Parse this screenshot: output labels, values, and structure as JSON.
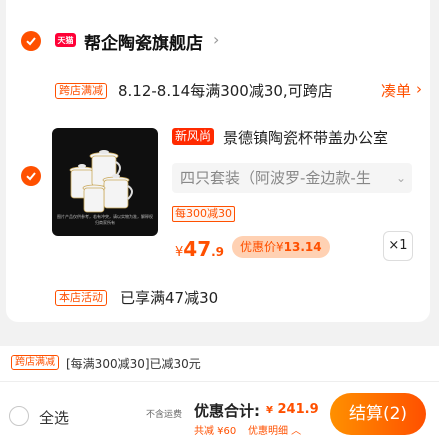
{
  "shop": {
    "badge": "天猫",
    "name": "帮企陶瓷旗舰店",
    "promo_tag": "跨店满减",
    "promo_text": "8.12-8.14每满300减30,可跨店",
    "coudan": "凑单"
  },
  "product": {
    "image_caption": "图片产品仅供参考，若有冲突，请以实物为准，解释权归商家所有",
    "new_badge": "新风尚",
    "title": "景德镇陶瓷杯带盖办公室",
    "sku": "四只套装（阿波罗-金边款-生",
    "cut_badge": "每300减30",
    "price_yen": "¥",
    "price_main": "47",
    "price_decimal": ".9",
    "coupon_label": "优惠价",
    "coupon_yen": "¥",
    "coupon_amount": "13.14",
    "quantity": "×1"
  },
  "store_activity": {
    "tag": "本店活动",
    "text": "已享满47减30"
  },
  "bottom": {
    "strip_tag": "跨店满减",
    "strip_text": "[每满300减30]已减30元",
    "select_all": "全选",
    "no_shipping": "不含运费",
    "total_label": "优惠合计:",
    "total_yen": "¥",
    "total_amount": "241.9",
    "savings": "共减 ¥60",
    "detail": "优惠明细 ︿",
    "checkout": "结算(2)"
  },
  "colors": {
    "accent": "#ff5000",
    "tmall": "#ff0036"
  }
}
